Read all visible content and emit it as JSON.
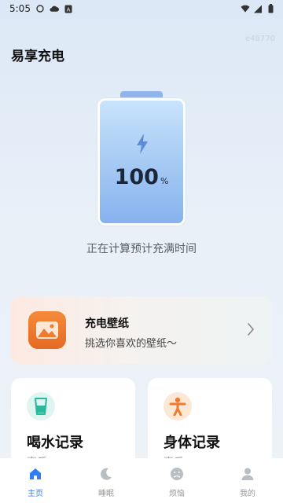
{
  "status_bar": {
    "time": "5:05"
  },
  "app": {
    "title": "易享充电",
    "watermark": "e48770"
  },
  "battery": {
    "value": "100",
    "unit": "%",
    "level_percent": 100,
    "status_text": "正在计算预计充满时间"
  },
  "wallpaper_card": {
    "title": "充电壁纸",
    "subtitle": "挑选你喜欢的壁纸～"
  },
  "records": [
    {
      "title": "喝水记录",
      "subtitle": "喜乐",
      "icon": "water-cup-icon",
      "icon_bg": "#dff5f1"
    },
    {
      "title": "身体记录",
      "subtitle": "喜乐",
      "icon": "body-icon",
      "icon_bg": "#fde8d6"
    }
  ],
  "nav": {
    "items": [
      {
        "label": "主页",
        "icon": "home-icon",
        "active": true
      },
      {
        "label": "睡眠",
        "icon": "moon-icon",
        "active": false
      },
      {
        "label": "烦恼",
        "icon": "sad-face-icon",
        "active": false
      },
      {
        "label": "我的",
        "icon": "profile-icon",
        "active": false
      }
    ]
  },
  "colors": {
    "accent": "#2f7ef5",
    "battery_fill": "#a9cdf4",
    "wallpaper_icon": "#f07a2e"
  }
}
